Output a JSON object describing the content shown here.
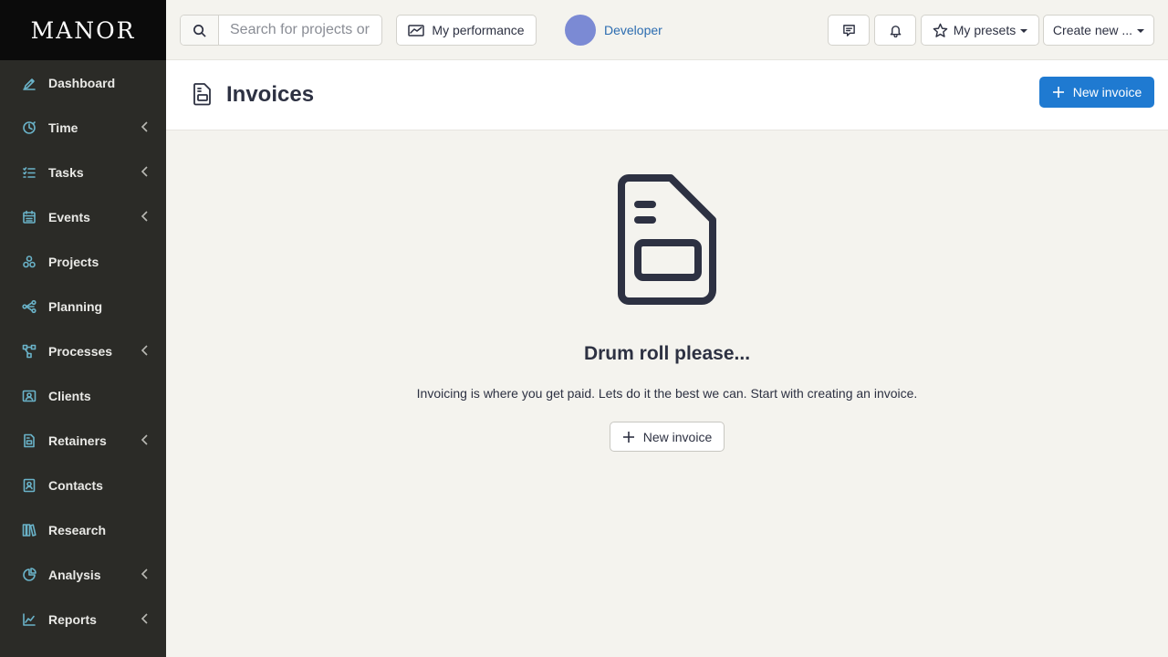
{
  "brand": "MANOR",
  "sidebar": {
    "items": [
      {
        "label": "Dashboard",
        "icon": "dashboard-icon",
        "expandable": false
      },
      {
        "label": "Time",
        "icon": "clock-icon",
        "expandable": true
      },
      {
        "label": "Tasks",
        "icon": "tasks-icon",
        "expandable": true
      },
      {
        "label": "Events",
        "icon": "calendar-icon",
        "expandable": true
      },
      {
        "label": "Projects",
        "icon": "projects-icon",
        "expandable": false
      },
      {
        "label": "Planning",
        "icon": "planning-icon",
        "expandable": false
      },
      {
        "label": "Processes",
        "icon": "processes-icon",
        "expandable": true
      },
      {
        "label": "Clients",
        "icon": "clients-icon",
        "expandable": false
      },
      {
        "label": "Retainers",
        "icon": "retainers-icon",
        "expandable": true
      },
      {
        "label": "Contacts",
        "icon": "contacts-icon",
        "expandable": false
      },
      {
        "label": "Research",
        "icon": "research-icon",
        "expandable": false
      },
      {
        "label": "Analysis",
        "icon": "analysis-icon",
        "expandable": true
      },
      {
        "label": "Reports",
        "icon": "reports-icon",
        "expandable": true
      }
    ]
  },
  "topbar": {
    "search_placeholder": "Search for projects or",
    "performance_label": "My performance",
    "user_name": "Developer",
    "avatar_color": "#7b8ad4",
    "presets_label": "My presets",
    "create_label": "Create new ..."
  },
  "page": {
    "title": "Invoices",
    "new_invoice_label": "New invoice"
  },
  "empty_state": {
    "title": "Drum roll please...",
    "text": "Invoicing is where you get paid. Lets do it the best we can. Start with creating an invoice.",
    "button_label": "New invoice"
  },
  "colors": {
    "sidebar_bg": "#2b2b27",
    "accent": "#1f7ad1",
    "icon_accent": "#6ab3c9"
  }
}
